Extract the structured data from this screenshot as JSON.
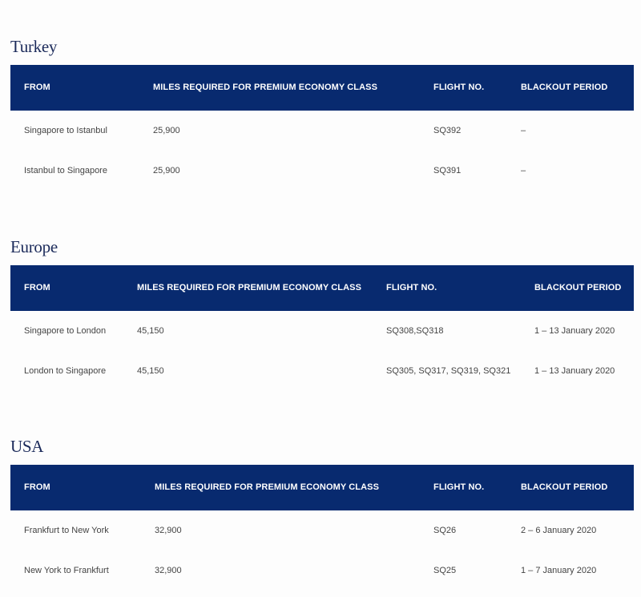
{
  "sections": [
    {
      "title": "Turkey",
      "headers": [
        "FROM",
        "MILES REQUIRED FOR PREMIUM ECONOMY CLASS",
        "FLIGHT NO.",
        "BLACKOUT PERIOD"
      ],
      "rows": [
        [
          "Singapore to Istanbul",
          "25,900",
          "SQ392",
          "–"
        ],
        [
          "Istanbul to Singapore",
          "25,900",
          "SQ391",
          "–"
        ]
      ]
    },
    {
      "title": "Europe",
      "headers": [
        "FROM",
        "MILES REQUIRED FOR PREMIUM ECONOMY CLASS",
        "FLIGHT NO.",
        "BLACKOUT PERIOD"
      ],
      "rows": [
        [
          "Singapore to London",
          "45,150",
          "SQ308,SQ318",
          "1 – 13 January 2020"
        ],
        [
          "London to Singapore",
          "45,150",
          "SQ305, SQ317, SQ319, SQ321",
          "1 – 13 January 2020"
        ]
      ]
    },
    {
      "title": "USA",
      "headers": [
        "FROM",
        "MILES REQUIRED FOR PREMIUM ECONOMY CLASS",
        "FLIGHT NO.",
        "BLACKOUT PERIOD"
      ],
      "rows": [
        [
          "Frankfurt to New York",
          "32,900",
          "SQ26",
          "2 – 6 January 2020"
        ],
        [
          "New York to Frankfurt",
          "32,900",
          "SQ25",
          "1 – 7 January 2020"
        ]
      ]
    }
  ]
}
